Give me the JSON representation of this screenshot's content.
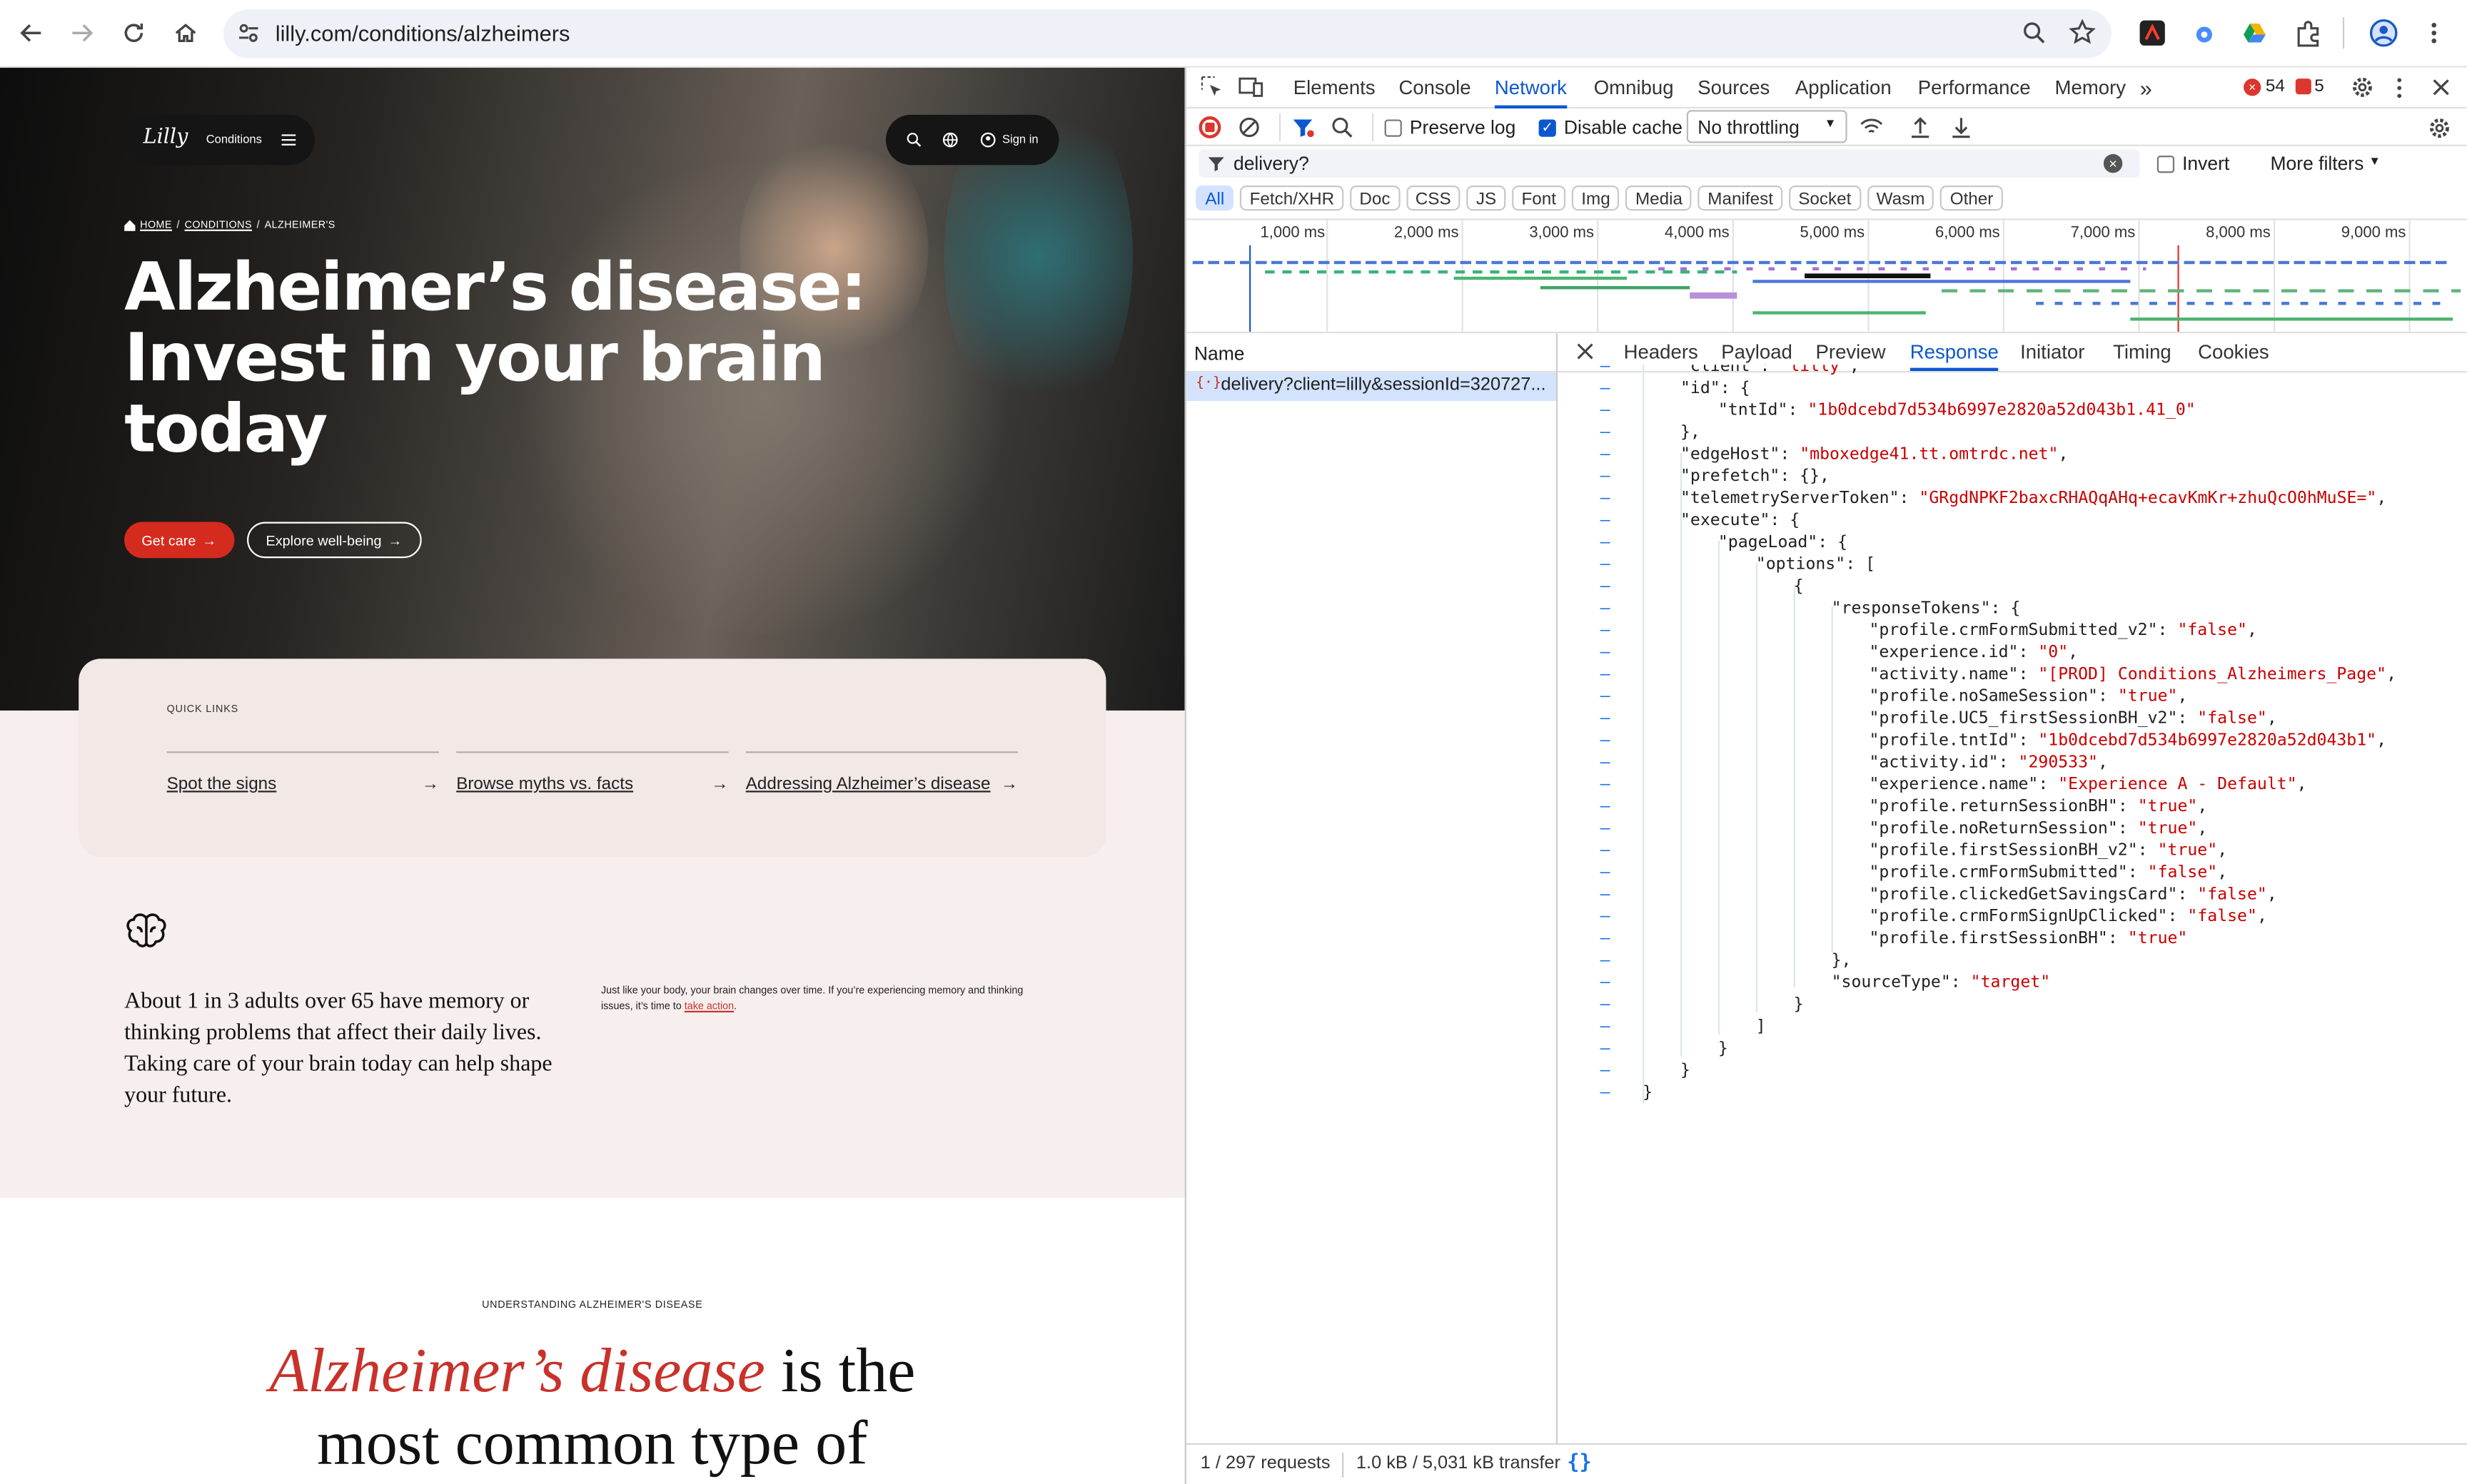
{
  "browser": {
    "url": "lilly.com/conditions/alzheimers",
    "icons": [
      "back-icon",
      "forward-icon",
      "reload-icon",
      "home-icon",
      "site-info-icon",
      "zoom-icon",
      "bookmark-star-icon",
      "extensions-icon",
      "profile-icon",
      "menu-icon"
    ]
  },
  "site": {
    "brand": "Lilly",
    "nav_label": "Conditions",
    "sign_in": "Sign in",
    "breadcrumb": [
      "HOME",
      "CONDITIONS",
      "ALZHEIMER'S"
    ],
    "hero_title": "Alzheimer’s disease: Invest in your brain today",
    "cta_primary": "Get care",
    "cta_secondary": "Explore well-being",
    "quick_links_label": "QUICK LINKS",
    "quick_links": [
      "Spot the signs",
      "Browse myths vs. facts",
      "Addressing Alzheimer’s disease"
    ],
    "stat_text": "About 1 in 3 adults over 65 have memory or thinking problems that affect their daily lives. Taking care of your brain today can help shape your future.",
    "side_text": "Just like your body, your brain changes over time. If you’re experiencing memory and thinking issues, it’s time to",
    "side_link": "take action",
    "section_label": "UNDERSTANDING ALZHEIMER'S DISEASE",
    "section_heading_em": "Alzheimer’s disease",
    "section_heading_rest": " is the",
    "section_heading_line2": "most common type of",
    "colors": {
      "accent_red": "#d52b1e",
      "pink_bg": "#f7efee"
    }
  },
  "devtools": {
    "tabs": [
      "Elements",
      "Console",
      "Network",
      "Omnibug",
      "Sources",
      "Application",
      "Performance",
      "Memory"
    ],
    "active_tab": "Network",
    "errors": "54",
    "warnings": "5",
    "preserve_log": "Preserve log",
    "disable_cache": "Disable cache",
    "throttle": "No throttling",
    "filter_value": "delivery?",
    "invert": "Invert",
    "more_filters": "More filters",
    "type_filters": [
      "All",
      "Fetch/XHR",
      "Doc",
      "CSS",
      "JS",
      "Font",
      "Img",
      "Media",
      "Manifest",
      "Socket",
      "Wasm",
      "Other"
    ],
    "timeline_ticks": [
      "1,000 ms",
      "2,000 ms",
      "3,000 ms",
      "4,000 ms",
      "5,000 ms",
      "6,000 ms",
      "7,000 ms",
      "8,000 ms",
      "9,000 ms"
    ],
    "name_header": "Name",
    "request_name": "delivery?client=lilly&sessionId=320727...",
    "detail_tabs": [
      "Headers",
      "Payload",
      "Preview",
      "Response",
      "Initiator",
      "Timing",
      "Cookies"
    ],
    "active_detail_tab": "Response",
    "response_lines": [
      {
        "indent": 1,
        "key": "\"client\"",
        "val": "\"lilly\"",
        "tail": ","
      },
      {
        "indent": 1,
        "key": "\"id\"",
        "val": "",
        "tail": ": {"
      },
      {
        "indent": 2,
        "key": "\"tntId\"",
        "val": "\"1b0dcebd7d534b6997e2820a52d043b1.41_0\"",
        "tail": ""
      },
      {
        "indent": 1,
        "key": "",
        "val": "",
        "tail": "},"
      },
      {
        "indent": 1,
        "key": "\"edgeHost\"",
        "val": "\"mboxedge41.tt.omtrdc.net\"",
        "tail": ","
      },
      {
        "indent": 1,
        "key": "\"prefetch\"",
        "val": "",
        "tail": ": {},"
      },
      {
        "indent": 1,
        "key": "\"telemetryServerToken\"",
        "val": "\"GRgdNPKF2baxcRHAQqAHq+ecavKmKr+zhuQcO0hMuSE=\"",
        "tail": ","
      },
      {
        "indent": 1,
        "key": "\"execute\"",
        "val": "",
        "tail": ": {"
      },
      {
        "indent": 2,
        "key": "\"pageLoad\"",
        "val": "",
        "tail": ": {"
      },
      {
        "indent": 3,
        "key": "\"options\"",
        "val": "",
        "tail": ": ["
      },
      {
        "indent": 4,
        "key": "",
        "val": "",
        "tail": "{"
      },
      {
        "indent": 5,
        "key": "\"responseTokens\"",
        "val": "",
        "tail": ": {"
      },
      {
        "indent": 6,
        "key": "\"profile.crmFormSubmitted_v2\"",
        "val": "\"false\"",
        "tail": ","
      },
      {
        "indent": 6,
        "key": "\"experience.id\"",
        "val": "\"0\"",
        "tail": ","
      },
      {
        "indent": 6,
        "key": "\"activity.name\"",
        "val": "\"[PROD] Conditions_Alzheimers_Page\"",
        "tail": ","
      },
      {
        "indent": 6,
        "key": "\"profile.noSameSession\"",
        "val": "\"true\"",
        "tail": ","
      },
      {
        "indent": 6,
        "key": "\"profile.UC5_firstSessionBH_v2\"",
        "val": "\"false\"",
        "tail": ","
      },
      {
        "indent": 6,
        "key": "\"profile.tntId\"",
        "val": "\"1b0dcebd7d534b6997e2820a52d043b1\"",
        "tail": ","
      },
      {
        "indent": 6,
        "key": "\"activity.id\"",
        "val": "\"290533\"",
        "tail": ","
      },
      {
        "indent": 6,
        "key": "\"experience.name\"",
        "val": "\"Experience A - Default\"",
        "tail": ","
      },
      {
        "indent": 6,
        "key": "\"profile.returnSessionBH\"",
        "val": "\"true\"",
        "tail": ","
      },
      {
        "indent": 6,
        "key": "\"profile.noReturnSession\"",
        "val": "\"true\"",
        "tail": ","
      },
      {
        "indent": 6,
        "key": "\"profile.firstSessionBH_v2\"",
        "val": "\"true\"",
        "tail": ","
      },
      {
        "indent": 6,
        "key": "\"profile.crmFormSubmitted\"",
        "val": "\"false\"",
        "tail": ","
      },
      {
        "indent": 6,
        "key": "\"profile.clickedGetSavingsCard\"",
        "val": "\"false\"",
        "tail": ","
      },
      {
        "indent": 6,
        "key": "\"profile.crmFormSignUpClicked\"",
        "val": "\"false\"",
        "tail": ","
      },
      {
        "indent": 6,
        "key": "\"profile.firstSessionBH\"",
        "val": "\"true\"",
        "tail": ""
      },
      {
        "indent": 5,
        "key": "",
        "val": "",
        "tail": "},"
      },
      {
        "indent": 5,
        "key": "\"sourceType\"",
        "val": "\"target\"",
        "tail": ""
      },
      {
        "indent": 4,
        "key": "",
        "val": "",
        "tail": "}"
      },
      {
        "indent": 3,
        "key": "",
        "val": "",
        "tail": "]"
      },
      {
        "indent": 2,
        "key": "",
        "val": "",
        "tail": "}"
      },
      {
        "indent": 1,
        "key": "",
        "val": "",
        "tail": "}"
      },
      {
        "indent": 0,
        "key": "",
        "val": "",
        "tail": "}"
      }
    ],
    "status_requests": "1 / 297 requests",
    "status_transfer": "1.0 kB / 5,031 kB transfer"
  }
}
